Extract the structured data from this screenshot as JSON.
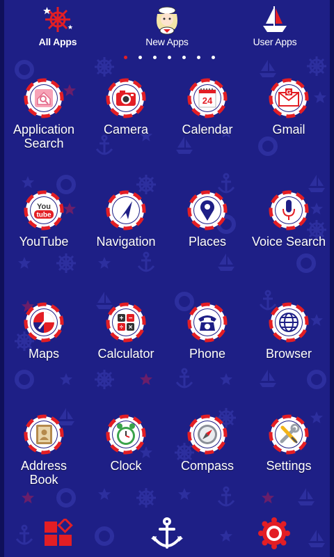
{
  "tabs": [
    {
      "label": "All Apps",
      "icon": "ship-wheel-icon",
      "active": true
    },
    {
      "label": "New Apps",
      "icon": "sailor-girl-icon",
      "active": false
    },
    {
      "label": "User Apps",
      "icon": "sailboat-icon",
      "active": false
    }
  ],
  "page_indicator": {
    "count": 7,
    "active_index": 0
  },
  "apps": [
    {
      "label": "Application Search",
      "icon": "app-search-icon"
    },
    {
      "label": "Camera",
      "icon": "camera-icon"
    },
    {
      "label": "Calendar",
      "icon": "calendar-icon",
      "day": "24"
    },
    {
      "label": "Gmail",
      "icon": "gmail-icon",
      "letter": "G"
    },
    {
      "label": "YouTube",
      "icon": "youtube-icon",
      "you": "You",
      "tube": "tube"
    },
    {
      "label": "Navigation",
      "icon": "navigation-arrow-icon"
    },
    {
      "label": "Places",
      "icon": "map-pin-icon"
    },
    {
      "label": "Voice Search",
      "icon": "microphone-icon"
    },
    {
      "label": "Maps",
      "icon": "maps-icon"
    },
    {
      "label": "Calculator",
      "icon": "calculator-icon"
    },
    {
      "label": "Phone",
      "icon": "telephone-icon"
    },
    {
      "label": "Browser",
      "icon": "globe-icon"
    },
    {
      "label": "Address Book",
      "icon": "address-book-icon"
    },
    {
      "label": "Clock",
      "icon": "alarm-clock-icon"
    },
    {
      "label": "Compass",
      "icon": "compass-icon"
    },
    {
      "label": "Settings",
      "icon": "wrench-screwdriver-icon"
    }
  ],
  "dock": [
    {
      "icon": "app-grid-icon"
    },
    {
      "icon": "anchor-icon"
    },
    {
      "icon": "gear-flower-icon"
    }
  ],
  "colors": {
    "background": "#1e1f86",
    "accent_red": "#e31e24",
    "white": "#ffffff",
    "pattern": "#2d2f9e"
  }
}
